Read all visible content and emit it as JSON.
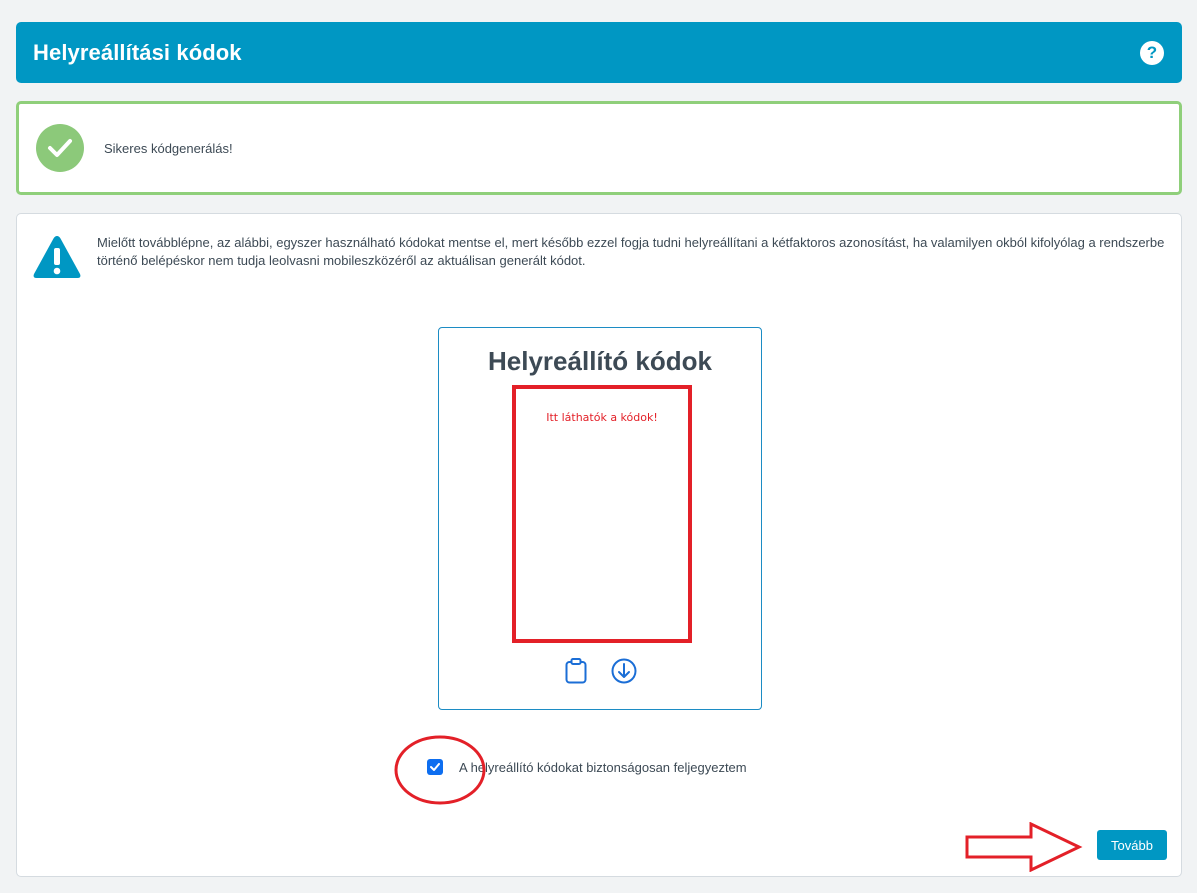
{
  "header": {
    "title": "Helyreállítási kódok",
    "help_label": "?"
  },
  "success": {
    "message": "Sikeres kódgenerálás!"
  },
  "warning": {
    "text": "Mielőtt továbblépne, az alábbi, egyszer használható kódokat mentse el, mert később ezzel fogja tudni helyreállítani a kétfaktoros azonosítást, ha valamilyen okból kifolyólag a rendszerbe történő belépéskor nem tudja leolvasni mobileszközéről az aktuálisan generált kódot."
  },
  "codes_card": {
    "title": "Helyreállító kódok",
    "note": "Itt láthatók a kódok!"
  },
  "confirm": {
    "label": "A helyreállító kódokat biztonságosan feljegyeztem",
    "checked": true
  },
  "next_button": {
    "label": "Tovább"
  },
  "colors": {
    "brand": "#0097c3",
    "success_border": "#8fcf7a",
    "annotation_red": "#e32028",
    "checkbox": "#0d6ef0"
  }
}
